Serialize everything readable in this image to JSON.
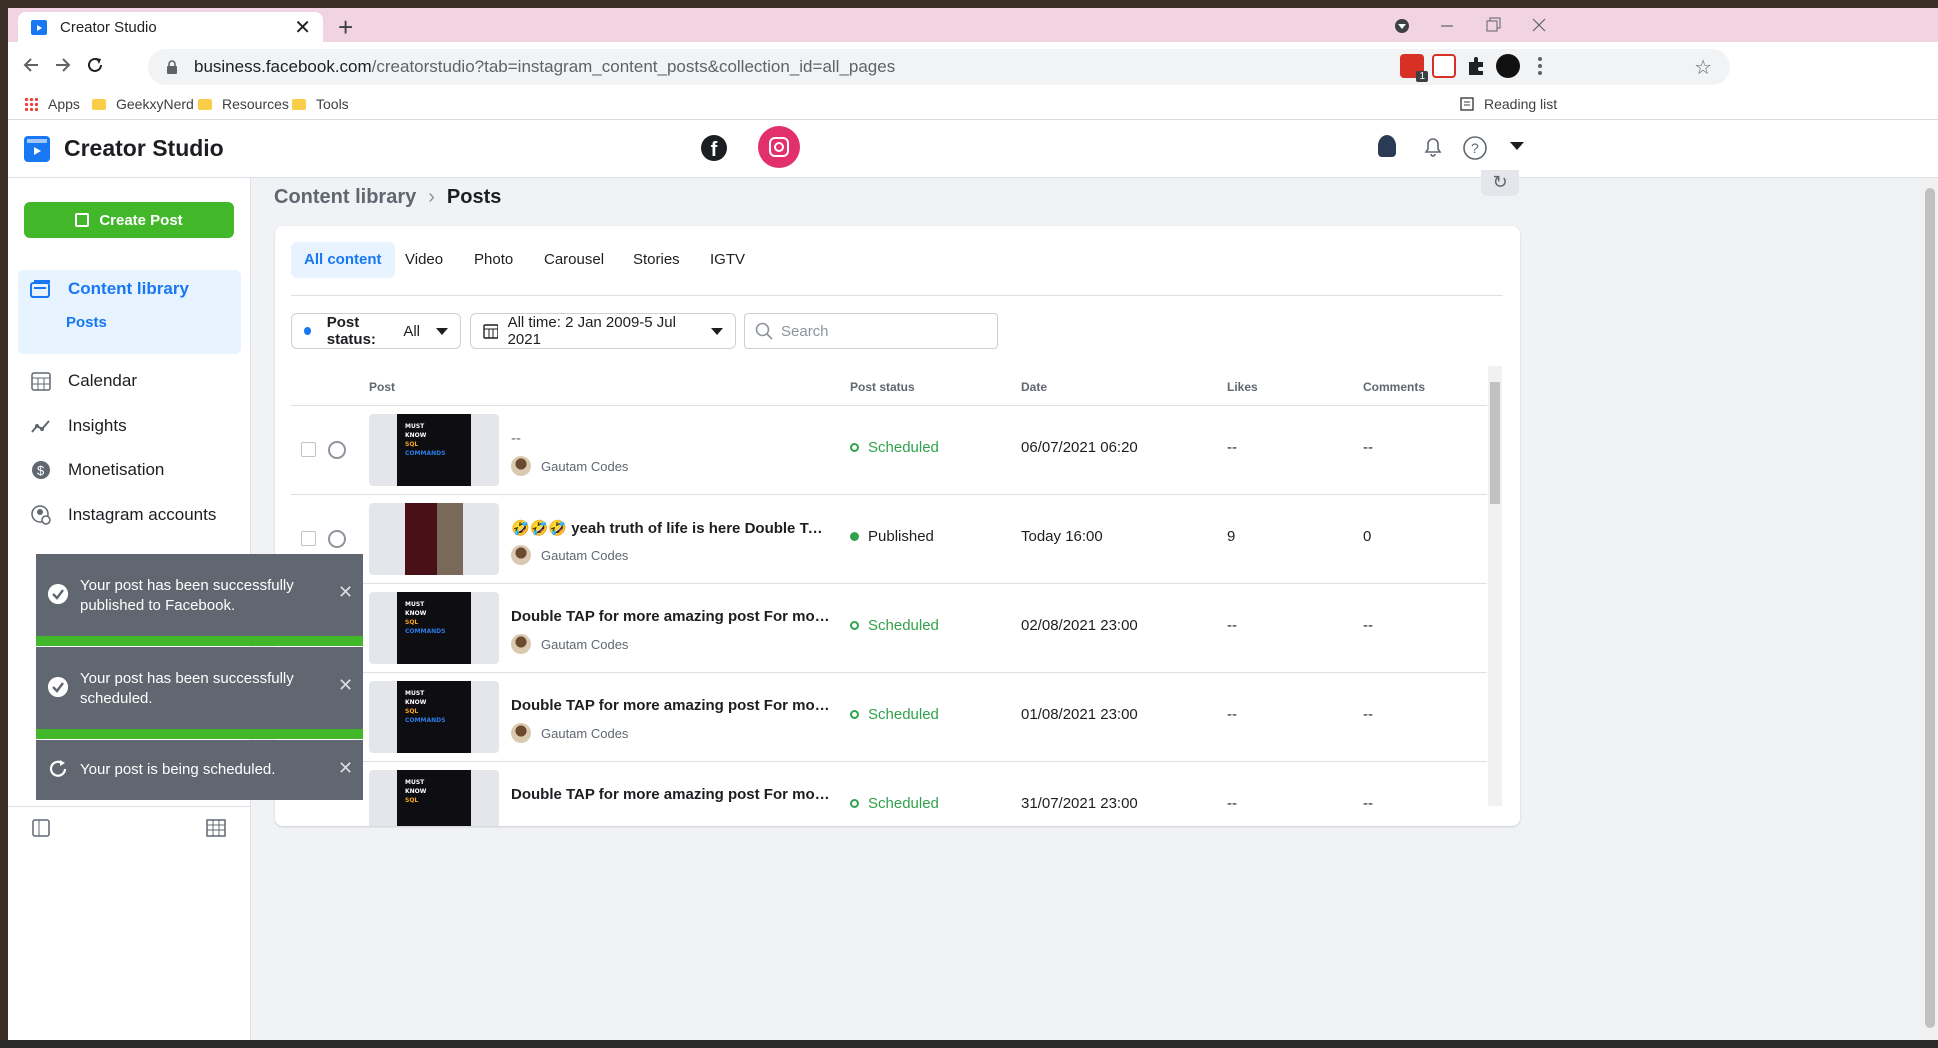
{
  "browser": {
    "tab_title": "Creator Studio",
    "new_tab": "+",
    "close_tab": "✕",
    "url_host": "business.facebook.com",
    "url_path": "/creatorstudio?tab=instagram_content_posts&collection_id=all_pages",
    "bookmarks": [
      "Apps",
      "GeekxyNerd",
      "Resources",
      "Tools"
    ],
    "reading_list": "Reading list",
    "ext_badge": "1"
  },
  "header": {
    "app_title": "Creator Studio"
  },
  "sidebar": {
    "create_post": "Create Post",
    "items": [
      {
        "label": "Content library",
        "sub": "Posts"
      },
      {
        "label": "Calendar"
      },
      {
        "label": "Insights"
      },
      {
        "label": "Monetisation"
      },
      {
        "label": "Instagram accounts"
      }
    ]
  },
  "breadcrumb": {
    "parent": "Content library",
    "current": "Posts"
  },
  "tabs": [
    "All content",
    "Video",
    "Photo",
    "Carousel",
    "Stories",
    "IGTV"
  ],
  "filters": {
    "status_label": "Post status: ",
    "status_value": "All",
    "date_range": "All time: 2 Jan 2009-5 Jul 2021",
    "search_placeholder": "Search"
  },
  "table": {
    "columns": [
      "Post",
      "Post status",
      "Date",
      "Likes",
      "Comments"
    ],
    "rows": [
      {
        "title": "--",
        "author": "Gautam Codes",
        "status": "Scheduled",
        "date": "06/07/2021 06:20",
        "likes": "--",
        "comments": "--"
      },
      {
        "title": "🤣🤣🤣 yeah truth of life is here Double TAP for more amazing post",
        "author": "Gautam Codes",
        "status": "Published",
        "date": "Today 16:00",
        "likes": "9",
        "comments": "0"
      },
      {
        "title": "Double TAP for more amazing post For more amazing post",
        "author": "Gautam Codes",
        "status": "Scheduled",
        "date": "02/08/2021 23:00",
        "likes": "--",
        "comments": "--"
      },
      {
        "title": "Double TAP for more amazing post For more amazing post",
        "author": "Gautam Codes",
        "status": "Scheduled",
        "date": "01/08/2021 23:00",
        "likes": "--",
        "comments": "--"
      },
      {
        "title": "Double TAP for more amazing post For more amazing post",
        "author": "Gautam Codes",
        "status": "Scheduled",
        "date": "31/07/2021 23:00",
        "likes": "--",
        "comments": "--"
      }
    ],
    "thumb_text": {
      "line1": "MUST",
      "line2": "KNOW",
      "line3": "SQL",
      "line4": "COMMANDS"
    }
  },
  "toasts": [
    {
      "message": "Your post has been successfully published to Facebook."
    },
    {
      "message": "Your post has been successfully scheduled."
    },
    {
      "message": "Your post is being scheduled."
    }
  ],
  "colors": {
    "accent": "#1877f2",
    "create_green": "#42b72a",
    "scheduled_green": "#31a24c",
    "instagram_pink": "#e1306c"
  }
}
